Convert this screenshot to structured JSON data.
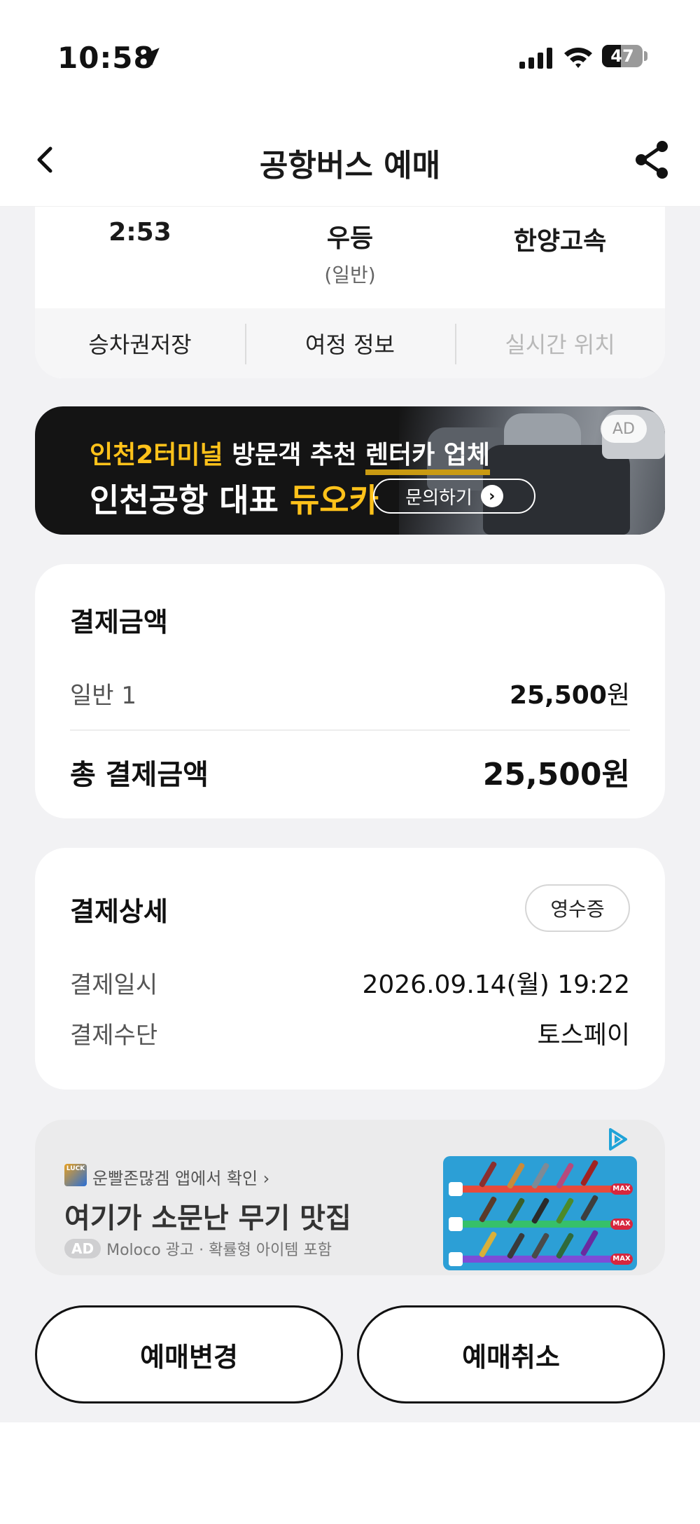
{
  "status_bar": {
    "time": "10:58",
    "battery_level": "47",
    "battery_fraction": 0.47,
    "icons": [
      "location-arrow-icon",
      "cellular-signal-icon",
      "wifi-icon",
      "battery-icon"
    ]
  },
  "header": {
    "title": "공항버스 예매",
    "back_icon": "chevron-left-icon",
    "share_icon": "share-icon"
  },
  "trip": {
    "time": "2:53",
    "grade": "우등",
    "grade_sub": "(일반)",
    "company": "한양고속",
    "actions": [
      {
        "label": "승차권저장",
        "enabled": true
      },
      {
        "label": "여정 정보",
        "enabled": true
      },
      {
        "label": "실시간 위치",
        "enabled": false
      }
    ]
  },
  "banner_ad": {
    "line1_highlight": "인천2터미널",
    "line1_mid": " 방문객 추천 ",
    "line1_underlined": "렌터카 업체",
    "line2_prefix": "인천공항 대표 ",
    "line2_brand": "듀오카",
    "cta": "문의하기",
    "ad_badge": "AD"
  },
  "payment_amount": {
    "title": "결제금액",
    "fare_label": "일반 1",
    "fare_amount": "25,500",
    "currency": "원",
    "total_label": "총 결제금액",
    "total_amount": "25,500원"
  },
  "payment_detail": {
    "title": "결제상세",
    "receipt_button": "영수증",
    "date_label": "결제일시",
    "date_value": "2026.09.14(월) 19:22",
    "method_label": "결제수단",
    "method_value": "토스페이"
  },
  "native_ad": {
    "app_logo_text": "LUCK",
    "source": "운빨존많겜 앱에서 확인 ›",
    "headline": "여기가 소문난 무기 맛집",
    "ad_tag": "AD",
    "meta": "Moloco 광고 · 확률형 아이템 포함",
    "thumb_max_label": "MAX"
  },
  "buttons": {
    "change": "예매변경",
    "cancel": "예매취소"
  },
  "colors": {
    "accent_yellow": "#ffc21a",
    "background": "#f2f2f4",
    "card": "#ffffff",
    "disabled_text": "#b8b8b8"
  }
}
